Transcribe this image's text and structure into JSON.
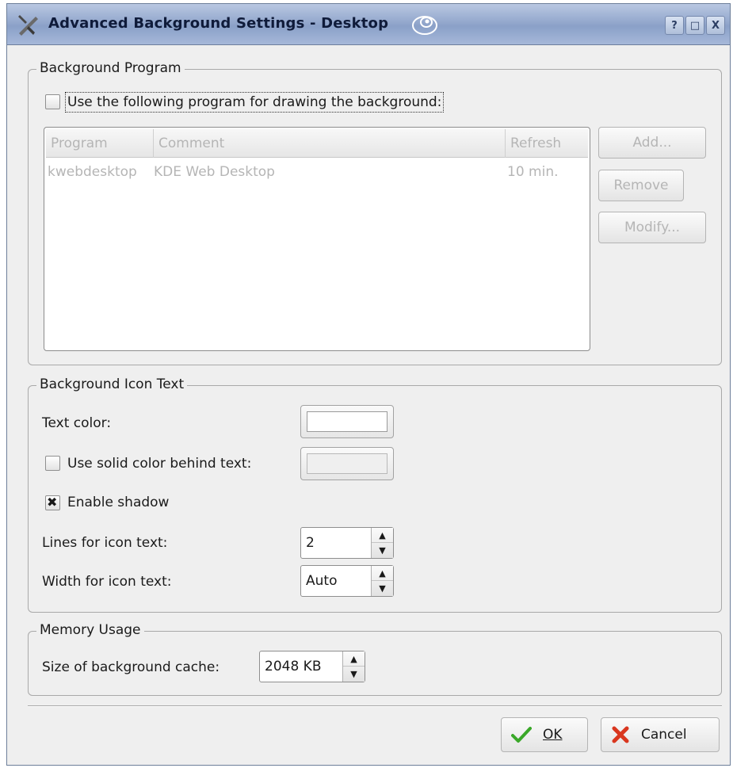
{
  "window": {
    "title": "Advanced Background Settings - Desktop",
    "help_button": "?",
    "maximize_button": "□",
    "close_button": "X"
  },
  "background_program": {
    "group_title": "Background Program",
    "use_program_checkbox": {
      "label": "Use the following program for drawing the background:",
      "checked": false
    },
    "list": {
      "columns": [
        "Program",
        "Comment",
        "Refresh"
      ],
      "rows": [
        {
          "program": "kwebdesktop",
          "comment": "KDE Web Desktop",
          "refresh": "10 min."
        }
      ]
    },
    "buttons": {
      "add": "Add...",
      "remove": "Remove",
      "modify": "Modify..."
    }
  },
  "icon_text": {
    "group_title": "Background Icon Text",
    "text_color_label": "Text color:",
    "text_color_value": "#ffffff",
    "solid_color_checkbox": {
      "label": "Use solid color behind text:",
      "checked": false
    },
    "enable_shadow_checkbox": {
      "label": "Enable shadow",
      "checked": true
    },
    "lines_label": "Lines for icon text:",
    "lines_value": "2",
    "width_label": "Width for icon text:",
    "width_value": "Auto"
  },
  "memory": {
    "group_title": "Memory Usage",
    "cache_label": "Size of background cache:",
    "cache_value": "2048 KB"
  },
  "dialog_buttons": {
    "ok": "OK",
    "cancel": "Cancel"
  },
  "colors": {
    "title_gradient_top": "#b9c8e2",
    "title_gradient_bottom": "#8aa0c8",
    "ok_check": "#3aa829",
    "cancel_x": "#d9371f",
    "disabled_text": "#b5b5b5"
  }
}
